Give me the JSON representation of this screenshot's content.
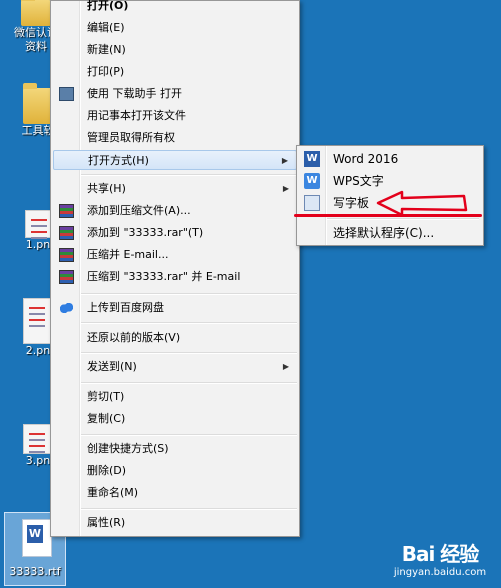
{
  "desktop": {
    "icons": [
      {
        "label": "微信认证",
        "label2": "资料"
      },
      {
        "label": "工具软"
      },
      {
        "label": "1.pn"
      },
      {
        "label": "2.pn"
      },
      {
        "label": "3.pn"
      }
    ],
    "selected_file": {
      "label": "33333.rtf",
      "glyph": "W"
    }
  },
  "context_menu": {
    "items": [
      {
        "label": "打开(O)"
      },
      {
        "label": "编辑(E)"
      },
      {
        "label": "新建(N)"
      },
      {
        "label": "打印(P)"
      },
      {
        "label": "使用 下载助手 打开"
      },
      {
        "label": "用记事本打开该文件"
      },
      {
        "label": "管理员取得所有权"
      },
      {
        "label": "打开方式(H)"
      },
      {
        "label": "共享(H)"
      },
      {
        "label": "添加到压缩文件(A)..."
      },
      {
        "label": "添加到 \"33333.rar\"(T)"
      },
      {
        "label": "压缩并 E-mail..."
      },
      {
        "label": "压缩到 \"33333.rar\" 并 E-mail"
      },
      {
        "label": "上传到百度网盘"
      },
      {
        "label": "还原以前的版本(V)"
      },
      {
        "label": "发送到(N)"
      },
      {
        "label": "剪切(T)"
      },
      {
        "label": "复制(C)"
      },
      {
        "label": "创建快捷方式(S)"
      },
      {
        "label": "删除(D)"
      },
      {
        "label": "重命名(M)"
      },
      {
        "label": "属性(R)"
      }
    ]
  },
  "open_with_submenu": {
    "items": [
      {
        "label": "Word 2016",
        "icon_text": "W"
      },
      {
        "label": "WPS文字",
        "icon_text": "W"
      },
      {
        "label": "写字板"
      },
      {
        "label": "选择默认程序(C)..."
      }
    ]
  },
  "watermark": {
    "logo": "Bai 经验",
    "url": "jingyan.baidu.com"
  },
  "colors": {
    "desktop": "#1b74b8",
    "annotation": "#e3001b",
    "menu_bg": "#f2f2f2"
  }
}
